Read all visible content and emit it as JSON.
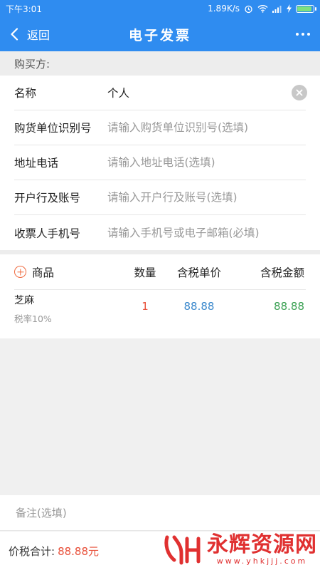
{
  "status_bar": {
    "time": "下午3:01",
    "network_speed": "1.89K/s"
  },
  "nav": {
    "back_label": "返回",
    "title": "电子发票"
  },
  "buyer": {
    "section_label": "购买方:",
    "fields": [
      {
        "label": "名称",
        "value": "个人",
        "placeholder": ""
      },
      {
        "label": "购货单位识别号",
        "value": "",
        "placeholder": "请输入购货单位识别号(选填)"
      },
      {
        "label": "地址电话",
        "value": "",
        "placeholder": "请输入地址电话(选填)"
      },
      {
        "label": "开户行及账号",
        "value": "",
        "placeholder": "请输入开户行及账号(选填)"
      },
      {
        "label": "收票人手机号",
        "value": "",
        "placeholder": "请输入手机号或电子邮箱(必填)"
      }
    ]
  },
  "goods": {
    "headers": {
      "name": "商品",
      "quantity": "数量",
      "unit_price": "含税单价",
      "amount": "含税金额"
    },
    "items": [
      {
        "name": "芝麻",
        "tax_rate": "税率10%",
        "quantity": "1",
        "unit_price": "88.88",
        "amount": "88.88"
      }
    ]
  },
  "remark": {
    "placeholder": "备注(选填)"
  },
  "footer": {
    "total_label": "价税合计:",
    "total_value": "88.88元"
  },
  "watermark": {
    "title": "永辉资源网",
    "url": "www.yhkjjj.com"
  },
  "colors": {
    "primary": "#2f8cf0",
    "quantity": "#e8503a",
    "price": "#3a88cc",
    "amount": "#3aa052",
    "total": "#e8503a"
  }
}
